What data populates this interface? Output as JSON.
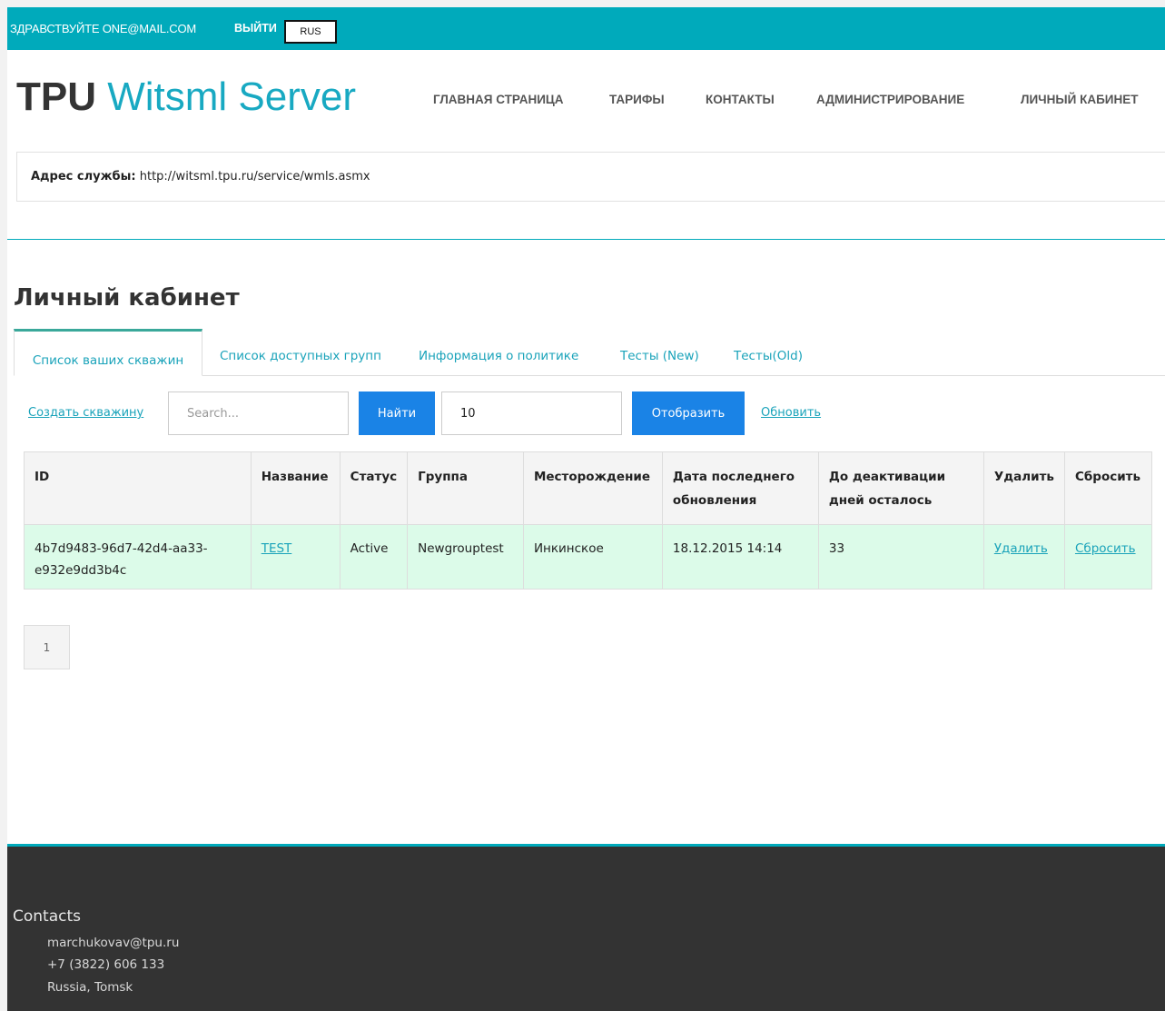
{
  "topbar": {
    "greeting": "ЗДРАВСТВУЙТЕ ONE@MAIL.COM",
    "logout": "ВЫЙТИ",
    "language": "RUS"
  },
  "brand": {
    "part1": "TPU",
    "part2": "Witsml Server"
  },
  "nav": {
    "items": [
      {
        "label": "ГЛАВНАЯ СТРАНИЦА"
      },
      {
        "label": "ТАРИФЫ"
      },
      {
        "label": "КОНТАКТЫ"
      },
      {
        "label": "АДМИНИСТРИРОВАНИЕ"
      },
      {
        "label": "ЛИЧНЫЙ КАБИНЕТ"
      }
    ]
  },
  "service": {
    "label": "Адрес службы:",
    "url": "http://witsml.tpu.ru/service/wmls.asmx"
  },
  "page_title": "Личный кабинет",
  "tabs": [
    {
      "label": "Список ваших скважин",
      "active": true
    },
    {
      "label": "Список доступных групп",
      "active": false
    },
    {
      "label": "Информация о политике",
      "active": false
    },
    {
      "label": "Тесты (New)",
      "active": false
    },
    {
      "label": "Тесты(Old)",
      "active": false
    }
  ],
  "toolbar": {
    "create_link": "Создать скважину",
    "search_placeholder": "Search...",
    "find_button": "Найти",
    "page_size_value": "10",
    "show_button": "Отобразить",
    "refresh_link": "Обновить"
  },
  "table": {
    "headers": [
      {
        "line1": "ID",
        "line2": ""
      },
      {
        "line1": "Название",
        "line2": ""
      },
      {
        "line1": "Статус",
        "line2": ""
      },
      {
        "line1": "Группа",
        "line2": ""
      },
      {
        "line1": "Месторождение",
        "line2": ""
      },
      {
        "line1": "Дата последнего",
        "line2": "обновления"
      },
      {
        "line1": "До деактивации",
        "line2": "дней осталось"
      },
      {
        "line1": "Удалить",
        "line2": ""
      },
      {
        "line1": "Сбросить",
        "line2": ""
      }
    ],
    "rows": [
      {
        "id_line1": "4b7d9483-96d7-42d4-aa33-",
        "id_line2": "e932e9dd3b4c",
        "name": "TEST",
        "status": "Active",
        "group": "Newgrouptest",
        "field": "Инкинское",
        "updated": "18.12.2015 14:14",
        "days_left": "33",
        "delete": "Удалить",
        "reset": "Сбросить"
      }
    ]
  },
  "pager": {
    "current": "1"
  },
  "footer": {
    "title": "Contacts",
    "email": "marchukovav@tpu.ru",
    "phone": "+7 (3822) 606 133",
    "location": "Russia, Tomsk"
  },
  "colors": {
    "accent": "#00aabb",
    "link": "#1aa3ba",
    "button": "#1a83e6",
    "row_bg": "#dcfbe9",
    "footer_bg": "#333333"
  }
}
